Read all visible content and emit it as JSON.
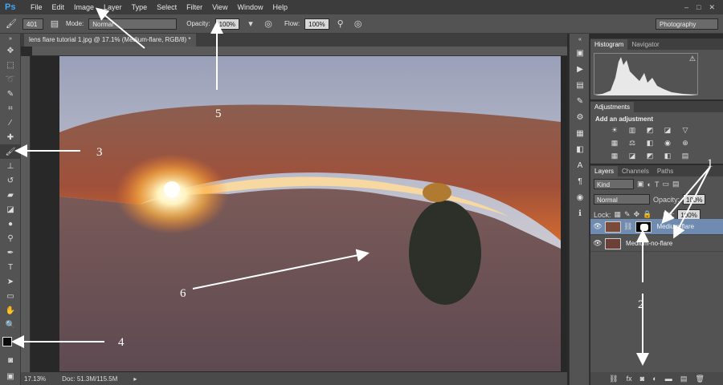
{
  "app": {
    "logo": "Ps"
  },
  "menu": [
    "File",
    "Edit",
    "Image",
    "Layer",
    "Type",
    "Select",
    "Filter",
    "View",
    "Window",
    "Help"
  ],
  "window_buttons": [
    "–",
    "□",
    "✕"
  ],
  "options": {
    "brush_size": "401",
    "mode_label": "Mode:",
    "mode_value": "Normal",
    "opacity_label": "Opacity:",
    "opacity_value": "100%",
    "flow_label": "Flow:",
    "flow_value": "100%",
    "workspace": "Photography"
  },
  "document": {
    "tab_title": "lens flare tutorial 1.jpg @ 17.1% (Medium-flare, RGB/8) *"
  },
  "status": {
    "zoom": "17.13%",
    "doc": "Doc: 51.3M/115.5M"
  },
  "panels": {
    "histogram_tabs": [
      "Histogram",
      "Navigator"
    ],
    "adjustments_tab": "Adjustments",
    "adjustments_title": "Add an adjustment",
    "layers_tabs": [
      "Layers",
      "Channels",
      "Paths"
    ],
    "kind_label": "Kind",
    "blend_mode": "Normal",
    "opacity_label": "Opacity:",
    "opacity_value": "100%",
    "lock_label": "Lock:",
    "fill_label": "Fill:",
    "fill_value": "100%",
    "layers": [
      {
        "name": "Medium-flare",
        "selected": true
      },
      {
        "name": "Medium-no-flare",
        "selected": false
      }
    ]
  },
  "annotations": [
    "1",
    "2",
    "3",
    "4",
    "5",
    "6"
  ],
  "colors": {
    "accent": "#3fa9f5",
    "selection": "#6f8bb0",
    "arrow": "#ffffff"
  }
}
